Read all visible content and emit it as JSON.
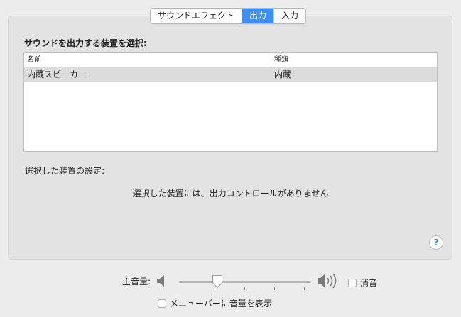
{
  "tabs": [
    {
      "label": "サウンドエフェクト",
      "active": false
    },
    {
      "label": "出力",
      "active": true
    },
    {
      "label": "入力",
      "active": false
    }
  ],
  "device_section": {
    "title": "サウンドを出力する装置を選択:",
    "columns": [
      "名前",
      "種類"
    ],
    "rows": [
      {
        "name": "内蔵スピーカー",
        "type": "内蔵",
        "selected": true
      }
    ]
  },
  "settings": {
    "title": "選択した装置の設定:",
    "message": "選択した装置には、出力コントロールがありません"
  },
  "help_label": "?",
  "volume": {
    "label": "主音量:",
    "level": 0.27,
    "mute_label": "消音",
    "mute_checked": false
  },
  "menubar_checkbox": {
    "label": "メニューバーに音量を表示",
    "checked": false
  },
  "colors": {
    "accent": "#3d8ef5",
    "selection": "#dcdcdc",
    "background": "#ececec"
  }
}
